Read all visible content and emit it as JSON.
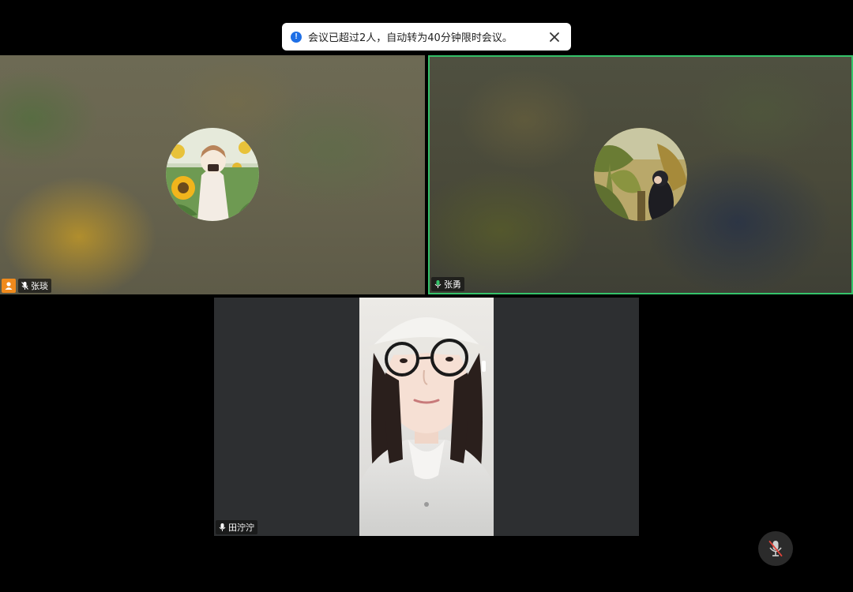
{
  "notification": {
    "message": "会议已超过2人，自动转为40分钟限时会议。",
    "icon": "info-icon",
    "close_icon": "close-icon",
    "info_glyph": "!"
  },
  "participants": [
    {
      "name": "张琰",
      "is_host": true,
      "mic": "muted",
      "active_speaker": false,
      "avatar": "avatar-sunflower"
    },
    {
      "name": "张勇",
      "is_host": false,
      "mic": "speaking",
      "active_speaker": true,
      "avatar": "avatar-plants"
    },
    {
      "name": "田泞泞",
      "is_host": false,
      "mic": "on",
      "video": true
    }
  ],
  "controls": {
    "mic_button": "microphone-muted-icon"
  },
  "colors": {
    "active_speaker_border": "#35c36a",
    "host_badge": "#f08a1c",
    "info_icon": "#1e6fe6",
    "mic_active": "#35c36a"
  }
}
